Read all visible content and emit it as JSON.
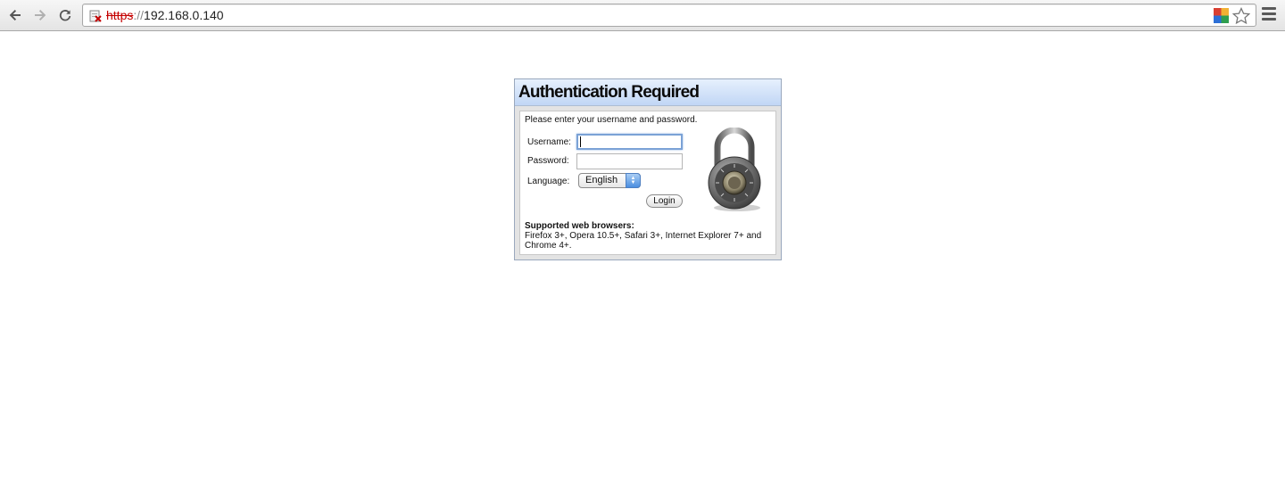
{
  "browser": {
    "url_scheme": "https",
    "url_separator": "://",
    "url_host": "192.168.0.140",
    "icons": {
      "back": "arrow-left-icon",
      "forward": "arrow-right-icon",
      "reload": "reload-icon",
      "security": "broken-lock-icon",
      "extension": "extension-icon",
      "bookmark": "star-icon",
      "menu": "hamburger-menu-icon"
    }
  },
  "auth": {
    "title": "Authentication Required",
    "prompt": "Please enter your username and password.",
    "username_label": "Username:",
    "username_value": "",
    "password_label": "Password:",
    "password_value": "",
    "language_label": "Language:",
    "language_selected": "English",
    "login_label": "Login",
    "supported_title": "Supported web browsers:",
    "supported_text": "Firefox 3+, Opera 10.5+, Safari 3+, Internet Explorer 7+ and Chrome 4+."
  },
  "colors": {
    "header_gradient_top": "#e6f0fd",
    "header_gradient_bottom": "#c1d6f5",
    "url_scheme_error": "#c40000"
  }
}
